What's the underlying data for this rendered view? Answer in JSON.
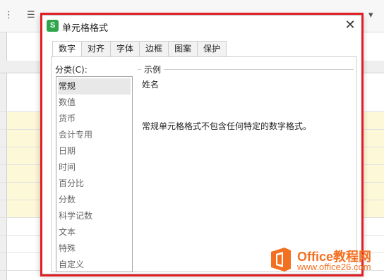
{
  "dialog": {
    "title": "单元格格式",
    "app_logo_letter": "S",
    "close_symbol": "✕"
  },
  "tabs": [
    {
      "label": "数字",
      "active": true
    },
    {
      "label": "对齐",
      "active": false
    },
    {
      "label": "字体",
      "active": false
    },
    {
      "label": "边框",
      "active": false
    },
    {
      "label": "图案",
      "active": false
    },
    {
      "label": "保护",
      "active": false
    }
  ],
  "category": {
    "label": "分类(C):",
    "items": [
      "常规",
      "数值",
      "货币",
      "会计专用",
      "日期",
      "时间",
      "百分比",
      "分数",
      "科学记数",
      "文本",
      "特殊",
      "自定义"
    ],
    "selected": "常规"
  },
  "sample": {
    "legend": "示例",
    "value": "姓名"
  },
  "description": "常规单元格格式不包含任何特定的数字格式。",
  "watermark": {
    "title": "Office教程网",
    "url": "www.office26.com"
  },
  "colors": {
    "highlight_border": "#e01e25",
    "app_logo": "#2fa54c",
    "watermark": "#f37021"
  }
}
